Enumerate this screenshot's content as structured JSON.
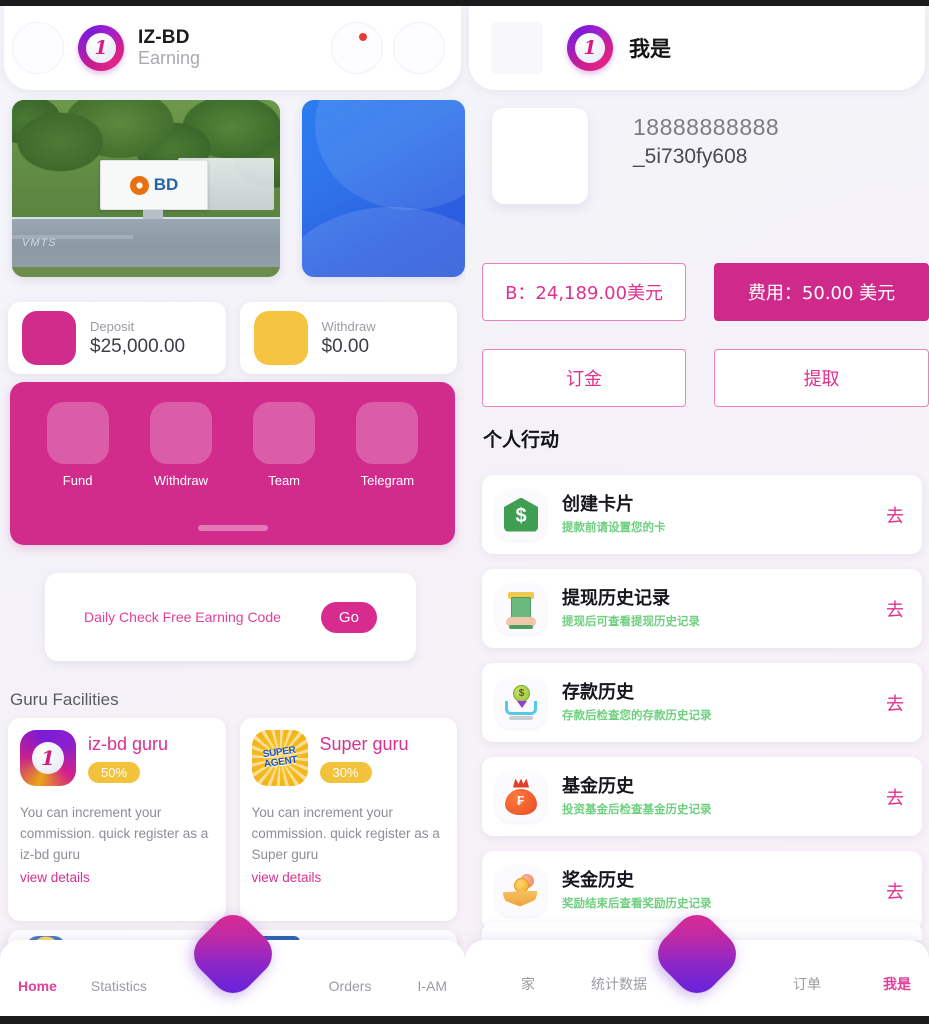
{
  "left": {
    "header": {
      "badge_number": "1",
      "title": "IZ-BD",
      "subtitle": "Earning",
      "notification_dot": true
    },
    "banners": {
      "primary_sign_text": "BD",
      "primary_wall_tag": "VMTS"
    },
    "stats": [
      {
        "label": "Deposit",
        "value": "$25,000.00",
        "color": "#d12b8c"
      },
      {
        "label": "Withdraw",
        "value": "$0.00",
        "color": "#f5c542"
      }
    ],
    "actions": [
      {
        "label": "Fund"
      },
      {
        "label": "Withdraw"
      },
      {
        "label": "Team"
      },
      {
        "label": "Telegram"
      }
    ],
    "promo": {
      "text": "Daily Check Free Earning Code",
      "button": "Go"
    },
    "guru_section_title": "Guru Facilities",
    "guru_cards": [
      {
        "badge": "1",
        "name": "iz-bd guru",
        "percent": "50%",
        "description": "You can increment your commission. quick register as a iz-bd guru",
        "link": "view details"
      },
      {
        "badge": "SUPER AGENT",
        "name": "Super guru",
        "percent": "30%",
        "description": "You can increment your commission. quick register as a Super guru",
        "link": "view details"
      }
    ],
    "nav": [
      {
        "label": "Home",
        "active": true
      },
      {
        "label": "Statistics",
        "active": false
      },
      {
        "label": "Orders",
        "active": false
      },
      {
        "label": "I-AM",
        "active": false
      }
    ]
  },
  "right": {
    "header": {
      "badge_number": "1",
      "title": "我是"
    },
    "profile": {
      "phone": "18888888888",
      "code": "_5i730fy608"
    },
    "balance_buttons": [
      {
        "label": "B：24,189.00美元",
        "style": "outline"
      },
      {
        "label": "费用：50.00 美元",
        "style": "solid"
      }
    ],
    "action_buttons": [
      {
        "label": "订金",
        "style": "outline"
      },
      {
        "label": "提取",
        "style": "outline"
      }
    ],
    "section_title": "个人行动",
    "list": [
      {
        "icon": "green-house-dollar-icon",
        "title": "创建卡片",
        "subtitle": "提款前请设置您的卡",
        "go": "去"
      },
      {
        "icon": "atm-withdraw-icon",
        "title": "提现历史记录",
        "subtitle": "提现后可查看提现历史记录",
        "go": "去"
      },
      {
        "icon": "deposit-coin-icon",
        "title": "存款历史",
        "subtitle": "存款后检查您的存款历史记录",
        "go": "去"
      },
      {
        "icon": "money-bag-icon",
        "title": "基金历史",
        "subtitle": "投资基金后检查基金历史记录",
        "go": "去"
      },
      {
        "icon": "reward-hand-coin-icon",
        "title": "奖金历史",
        "subtitle": "奖励结束后查看奖励历史记录",
        "go": "去"
      }
    ],
    "nav": [
      {
        "label": "家",
        "active": false
      },
      {
        "label": "统计数据",
        "active": false
      },
      {
        "label": "订单",
        "active": false
      },
      {
        "label": "我是",
        "active": true
      }
    ]
  },
  "theme": {
    "accent_pink": "#d12b8c",
    "accent_pink_light": "#e0409a",
    "accent_yellow": "#f5c542",
    "green_sub": "#6ed07f",
    "fab_gradient_from": "#e0298f",
    "fab_gradient_to": "#5b21e0"
  }
}
